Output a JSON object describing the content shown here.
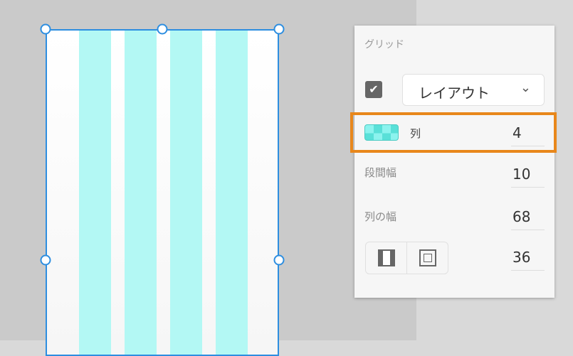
{
  "canvas": {
    "artboard_columns": 4,
    "accent": "#2d8ee0",
    "column_color": "#b3f8f4"
  },
  "panel": {
    "title": "グリッド",
    "grid_enabled": true,
    "grid_type": "レイアウト",
    "columns_label": "列",
    "columns_value": "4",
    "gutter_label": "段間幅",
    "gutter_value": "10",
    "column_width_label": "列の幅",
    "column_width_value": "68",
    "margin_value": "36",
    "highlight_color": "#e8871b"
  }
}
